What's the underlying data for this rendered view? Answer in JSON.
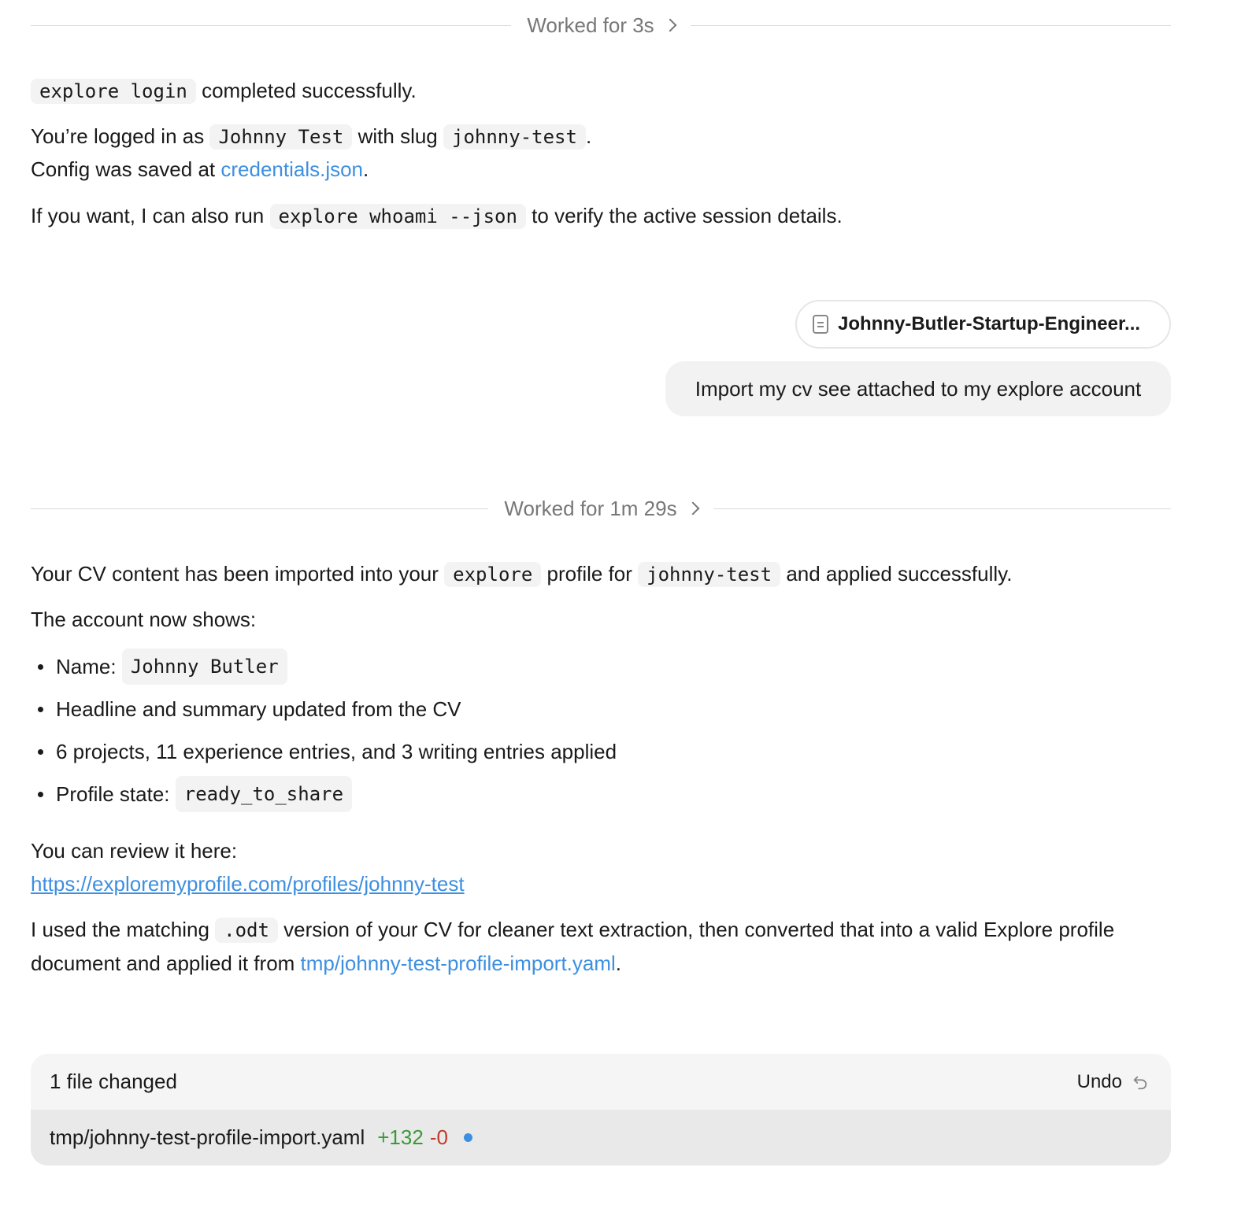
{
  "dividers": [
    {
      "label": "Worked for 3s"
    },
    {
      "label": "Worked for 1m 29s"
    }
  ],
  "response1": {
    "line1": {
      "code": "explore login",
      "text": " completed successfully."
    },
    "line2": {
      "pre": "You’re logged in as ",
      "code1": "Johnny Test",
      "mid": " with slug ",
      "code2": "johnny-test",
      "post": "."
    },
    "line3": {
      "pre": "Config was saved at ",
      "link": "credentials.json",
      "post": "."
    },
    "line4": {
      "pre": "If you want, I can also run ",
      "code": "explore whoami --json",
      "post": " to verify the active session details."
    }
  },
  "user_message": {
    "attachment": "Johnny-Butler-Startup-Engineer...",
    "text": "Import my cv see attached to my explore account"
  },
  "response2": {
    "line1": {
      "pre": "Your CV content has been imported into your ",
      "code1": "explore",
      "mid": " profile for ",
      "code2": "johnny-test",
      "post": " and applied successfully."
    },
    "line2": "The account now shows:",
    "bullets": {
      "name_label": "Name: ",
      "name_code": "Johnny Butler",
      "headline": "Headline and summary updated from the CV",
      "counts": "6 projects, 11 experience entries, and 3 writing entries applied",
      "state_label": "Profile state: ",
      "state_code": "ready_to_share"
    },
    "review_text": "You can review it here:",
    "review_link": "https://exploremyprofile.com/profiles/johnny-test",
    "final": {
      "pre": "I used the matching ",
      "code": ".odt",
      "mid": " version of your CV for cleaner text extraction, then converted that into a valid Explore profile document and applied it from ",
      "link": "tmp/johnny-test-profile-import.yaml",
      "post": "."
    }
  },
  "changes": {
    "title": "1 file changed",
    "undo_label": "Undo",
    "file": {
      "path": "tmp/johnny-test-profile-import.yaml",
      "added": "+132",
      "removed": "-0"
    }
  },
  "colors": {
    "link": "#3d8fe0",
    "added": "#3a9a3a",
    "removed": "#c0392b",
    "bubble": "#f2f2f2"
  },
  "icons": [
    "chevron-right-icon",
    "document-icon",
    "undo-icon",
    "unsaved-dot-icon"
  ]
}
